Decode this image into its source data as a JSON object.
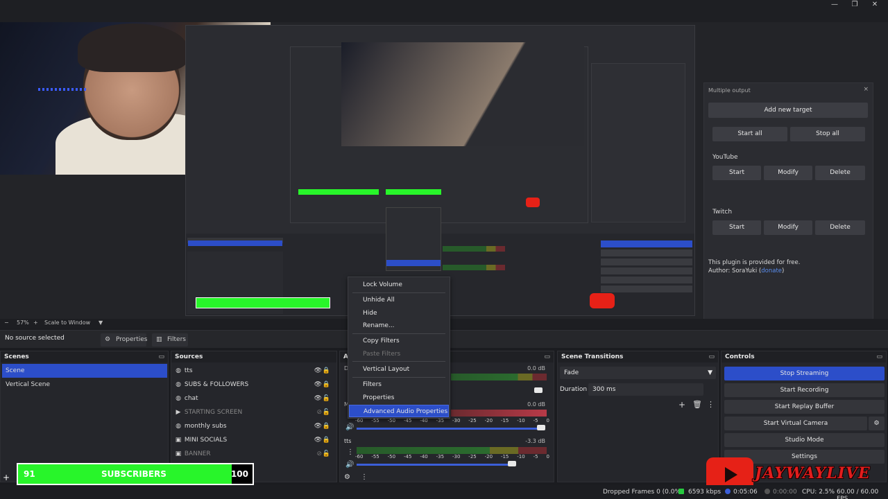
{
  "window": {
    "minimize": "—",
    "restore": "❐",
    "close": "✕"
  },
  "preview": {
    "multiple_output": {
      "title": "Multiple output",
      "close": "×",
      "add_target": "Add new target",
      "start_all": "Start all",
      "stop_all": "Stop all",
      "targets": [
        {
          "name": "YouTube",
          "start": "Start",
          "modify": "Modify",
          "delete": "Delete"
        },
        {
          "name": "Twitch",
          "start": "Start",
          "modify": "Modify",
          "delete": "Delete"
        }
      ],
      "footer_line1": "This plugin is provided for free.",
      "footer_line2": "Author: SoraYuki (",
      "footer_link": "donate",
      "footer_end": ")"
    }
  },
  "zoom": {
    "minus": "−",
    "value": "57%",
    "plus": "+",
    "scale_label": "Scale to Window",
    "dropdown": "▼"
  },
  "source_bar": {
    "status": "No source selected",
    "properties": "Properties",
    "filters": "Filters"
  },
  "scenes": {
    "title": "Scenes",
    "items": [
      {
        "label": "Scene"
      },
      {
        "label": "Vertical Scene"
      }
    ]
  },
  "sources": {
    "title": "Sources",
    "items": [
      {
        "label": "tts",
        "icon": "globe-icon"
      },
      {
        "label": "SUBS & FOLLOWERS",
        "icon": "globe-icon"
      },
      {
        "label": "chat",
        "icon": "globe-icon"
      },
      {
        "label": "STARTING SCREEN",
        "icon": "play-icon"
      },
      {
        "label": "monthly subs",
        "icon": "globe-icon"
      },
      {
        "label": "MINI SOCIALS",
        "icon": "image-icon"
      },
      {
        "label": "BANNER",
        "icon": "image-icon"
      }
    ]
  },
  "audio": {
    "title": "A",
    "tracks": [
      {
        "name": "D",
        "db": "0.0 dB"
      },
      {
        "name": "M",
        "db": "0.0 dB"
      },
      {
        "name": "tts",
        "db": "-3.3 dB"
      }
    ],
    "ticks": [
      "-60",
      "-55",
      "-50",
      "-45",
      "-40",
      "-35",
      "-30",
      "-25",
      "-20",
      "-15",
      "-10",
      "-5",
      "0"
    ]
  },
  "transitions": {
    "title": "Scene Transitions",
    "selected": "Fade",
    "duration_label": "Duration",
    "duration_value": "300 ms"
  },
  "controls": {
    "title": "Controls",
    "stop_streaming": "Stop Streaming",
    "start_recording": "Start Recording",
    "start_replay": "Start Replay Buffer",
    "start_virtual_camera": "Start Virtual Camera",
    "studio_mode": "Studio Mode",
    "settings": "Settings"
  },
  "context_menu": {
    "lock_volume": "Lock Volume",
    "unhide_all": "Unhide All",
    "hide": "Hide",
    "rename": "Rename...",
    "copy_filters": "Copy Filters",
    "paste_filters": "Paste Filters",
    "vertical_layout": "Vertical Layout",
    "filters": "Filters",
    "properties": "Properties",
    "advanced_audio": "Advanced Audio Properties"
  },
  "subs_bar": {
    "left": "91",
    "label": "SUBSCRIBERS",
    "right": "100",
    "progress": 0.91
  },
  "logo": {
    "text": "JAYWAYLIVE"
  },
  "status_bar": {
    "dropped": "Dropped Frames 0 (0.0%)",
    "bitrate": "6593 kbps",
    "stream_time": "0:05:06",
    "record_time": "0:00:00",
    "cpu": "CPU: 2.5%",
    "fps": "60.00 / 60.00 FPS"
  },
  "colors": {
    "accent": "#2c4ec9",
    "subs_green": "#28f52a",
    "logo_red": "#e21d1d"
  }
}
